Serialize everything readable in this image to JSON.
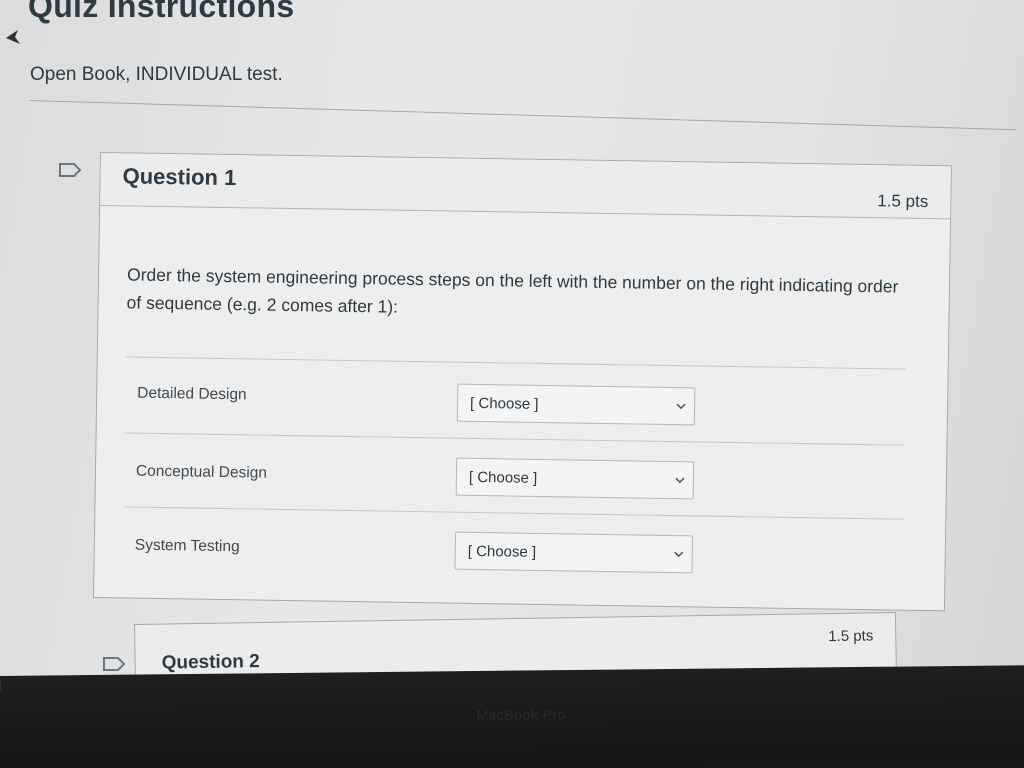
{
  "page": {
    "title": "Quiz Instructions",
    "instructions": "Open Book, INDIVIDUAL test."
  },
  "question1": {
    "title": "Question 1",
    "points": "1.5 pts",
    "prompt": "Order the system engineering process steps on the left with the number on the right indicating order of sequence (e.g. 2 comes after 1):",
    "matches": [
      {
        "label": "Detailed Design",
        "selected": "[ Choose ]"
      },
      {
        "label": "Conceptual Design",
        "selected": "[ Choose ]"
      },
      {
        "label": "System Testing",
        "selected": "[ Choose ]"
      }
    ]
  },
  "question2": {
    "title": "Question 2",
    "points": "1.5 pts"
  },
  "device": {
    "bezel_label": "MacBook Pro"
  },
  "icons": {
    "flag": "flag-icon",
    "dropdown": "chevron-down-icon",
    "cursor": "cursor-arrow-icon"
  },
  "colors": {
    "text": "#2d3b45",
    "border": "#a9a9a9",
    "background": "#e6e6e6"
  }
}
